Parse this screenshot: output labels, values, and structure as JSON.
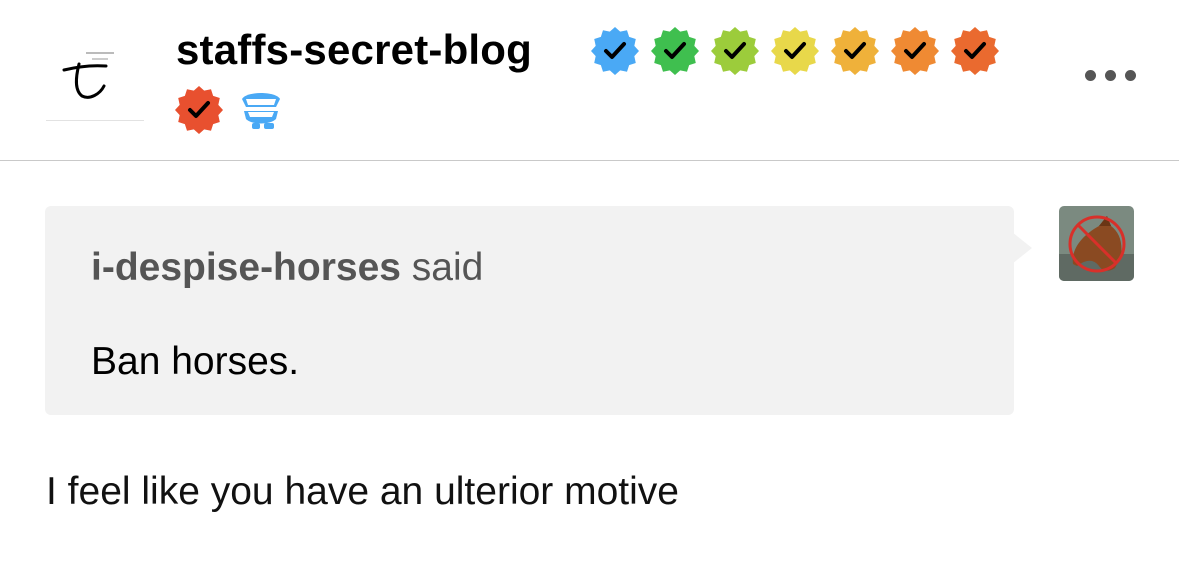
{
  "header": {
    "blog_name": "staffs-secret-blog",
    "badges": [
      {
        "icon": "check-badge-icon",
        "color": "#4aa9f5"
      },
      {
        "icon": "check-badge-icon",
        "color": "#3fbf4f"
      },
      {
        "icon": "check-badge-icon",
        "color": "#9ccc3b"
      },
      {
        "icon": "check-badge-icon",
        "color": "#e8d84a"
      },
      {
        "icon": "check-badge-icon",
        "color": "#efb13a"
      },
      {
        "icon": "check-badge-icon",
        "color": "#ef8a33"
      },
      {
        "icon": "check-badge-icon",
        "color": "#ea6a2f"
      },
      {
        "icon": "check-badge-icon",
        "color": "#e8502f"
      },
      {
        "icon": "chattering-teeth-icon",
        "color": "#4aa9f5"
      }
    ],
    "more_icon": "ellipsis-icon"
  },
  "ask": {
    "asker": "i-despise-horses",
    "said": "said",
    "question": "Ban horses."
  },
  "answer": {
    "text": "I feel like you have an ulterior motive"
  }
}
